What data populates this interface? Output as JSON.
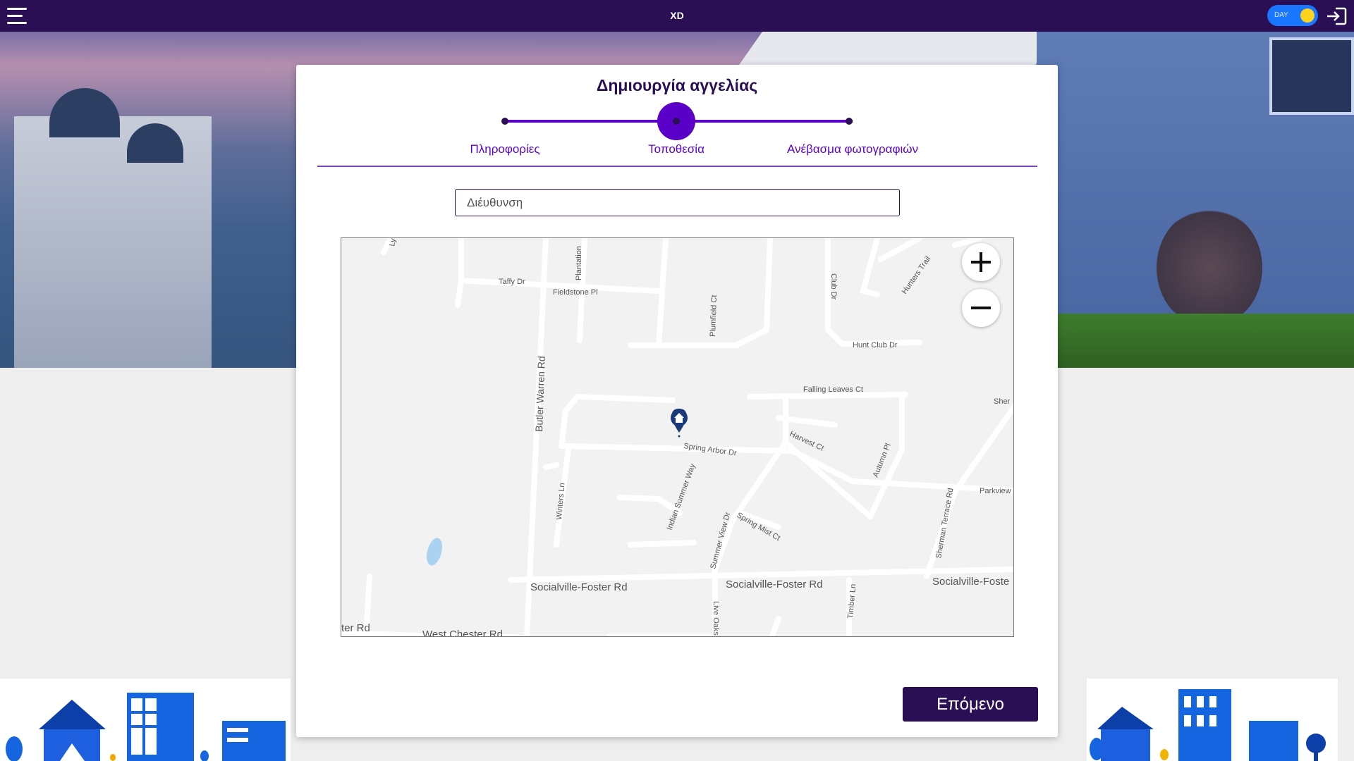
{
  "header": {
    "title": "XD",
    "theme_toggle_label": "DAY"
  },
  "card": {
    "title": "Δημιουργία αγγελίας",
    "steps": [
      {
        "label": "Πληροφορίες",
        "active": false
      },
      {
        "label": "Τοποθεσία",
        "active": true
      },
      {
        "label": "Ανέβασμα φωτογραφιών",
        "active": false
      }
    ],
    "address": {
      "placeholder": "Διέυθυνση",
      "value": ""
    },
    "next_label": "Επόμενο"
  },
  "map": {
    "streets": [
      "Taffy Dr",
      "Fieldstone Pl",
      "Plantation",
      "Plumfield Ct",
      "Club Dr",
      "Hunters Trail",
      "Hunt Club Dr",
      "Butler Warren Rd",
      "Falling Leaves Ct",
      "Harvest Ct",
      "Spring Arbor Dr",
      "Indian Summer Way",
      "Autumn Pl",
      "Sherman Terrace Rd",
      "Parkview",
      "Winters Ln",
      "Summer View Dr",
      "Spring Mist Ct",
      "Socialville-Foster Rd",
      "Socialville-Foster Rd",
      "Socialville-Foste",
      "Live Oaks Dr",
      "Timber Ln",
      "ter Rd",
      "West Chester Rd",
      "Sher",
      "Ly"
    ],
    "marker_icon": "home-marker-icon",
    "zoom_in_icon": "plus-icon",
    "zoom_out_icon": "minus-icon"
  },
  "colors": {
    "primary": "#2a0f55",
    "accent": "#5b00c8",
    "toggle": "#1976ff",
    "knob": "#ffd21f"
  }
}
